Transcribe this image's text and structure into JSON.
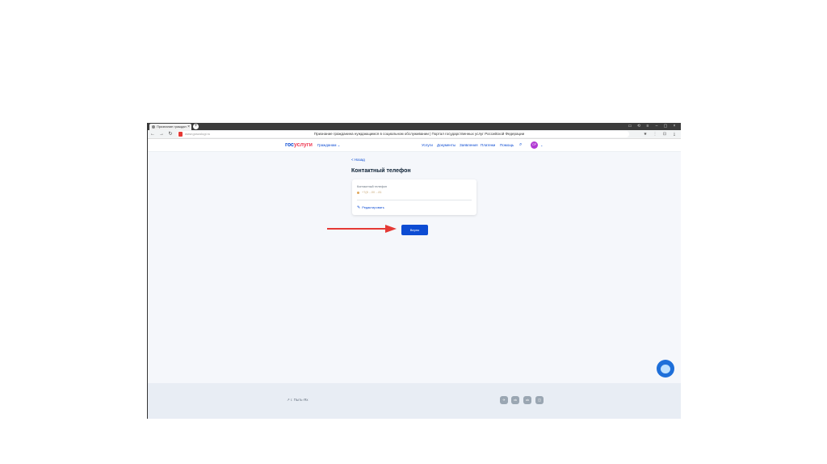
{
  "browser": {
    "tab_title": "Признание граждан",
    "tab_close": "×",
    "new_tab": "+",
    "window_controls": [
      "▭",
      "⟲",
      "≡",
      "–",
      "▢",
      "×"
    ],
    "nav_icons": {
      "back": "←",
      "forward": "→",
      "reload": "↻"
    },
    "url": "www.gosuslugi.ru",
    "page_title": "Признание гражданина нуждающимся в социальном обслуживании | Портал государственных услуг Российской Федерации",
    "right_icons": [
      "★",
      "⋮",
      "⊡",
      "⤓"
    ]
  },
  "header": {
    "logo_part1": "гос",
    "logo_part2": "услуги",
    "role": "Гражданам ⌄",
    "nav": [
      "Услуги",
      "Документы",
      "Заявления",
      "Платежи",
      "Помощь"
    ],
    "search_icon": "⌕",
    "avatar_initials": "СР",
    "avatar_chevron": "⌄"
  },
  "content": {
    "back_link": "< Назад",
    "title": "Контактный телефон",
    "card": {
      "label": "Контактный телефон",
      "value": "+7(8  ...00  ...81",
      "edit_label": "Редактировать",
      "edit_icon": "✎"
    },
    "button_label": "Верно"
  },
  "footer": {
    "text": "↗ г. Пыть-Ях",
    "social": [
      "✈",
      "vk",
      "ok",
      "◫"
    ]
  },
  "colors": {
    "brand_blue": "#0d4cd3",
    "brand_red": "#ee3f58",
    "arrow_red": "#e53935",
    "background": "#f5f7fb"
  }
}
